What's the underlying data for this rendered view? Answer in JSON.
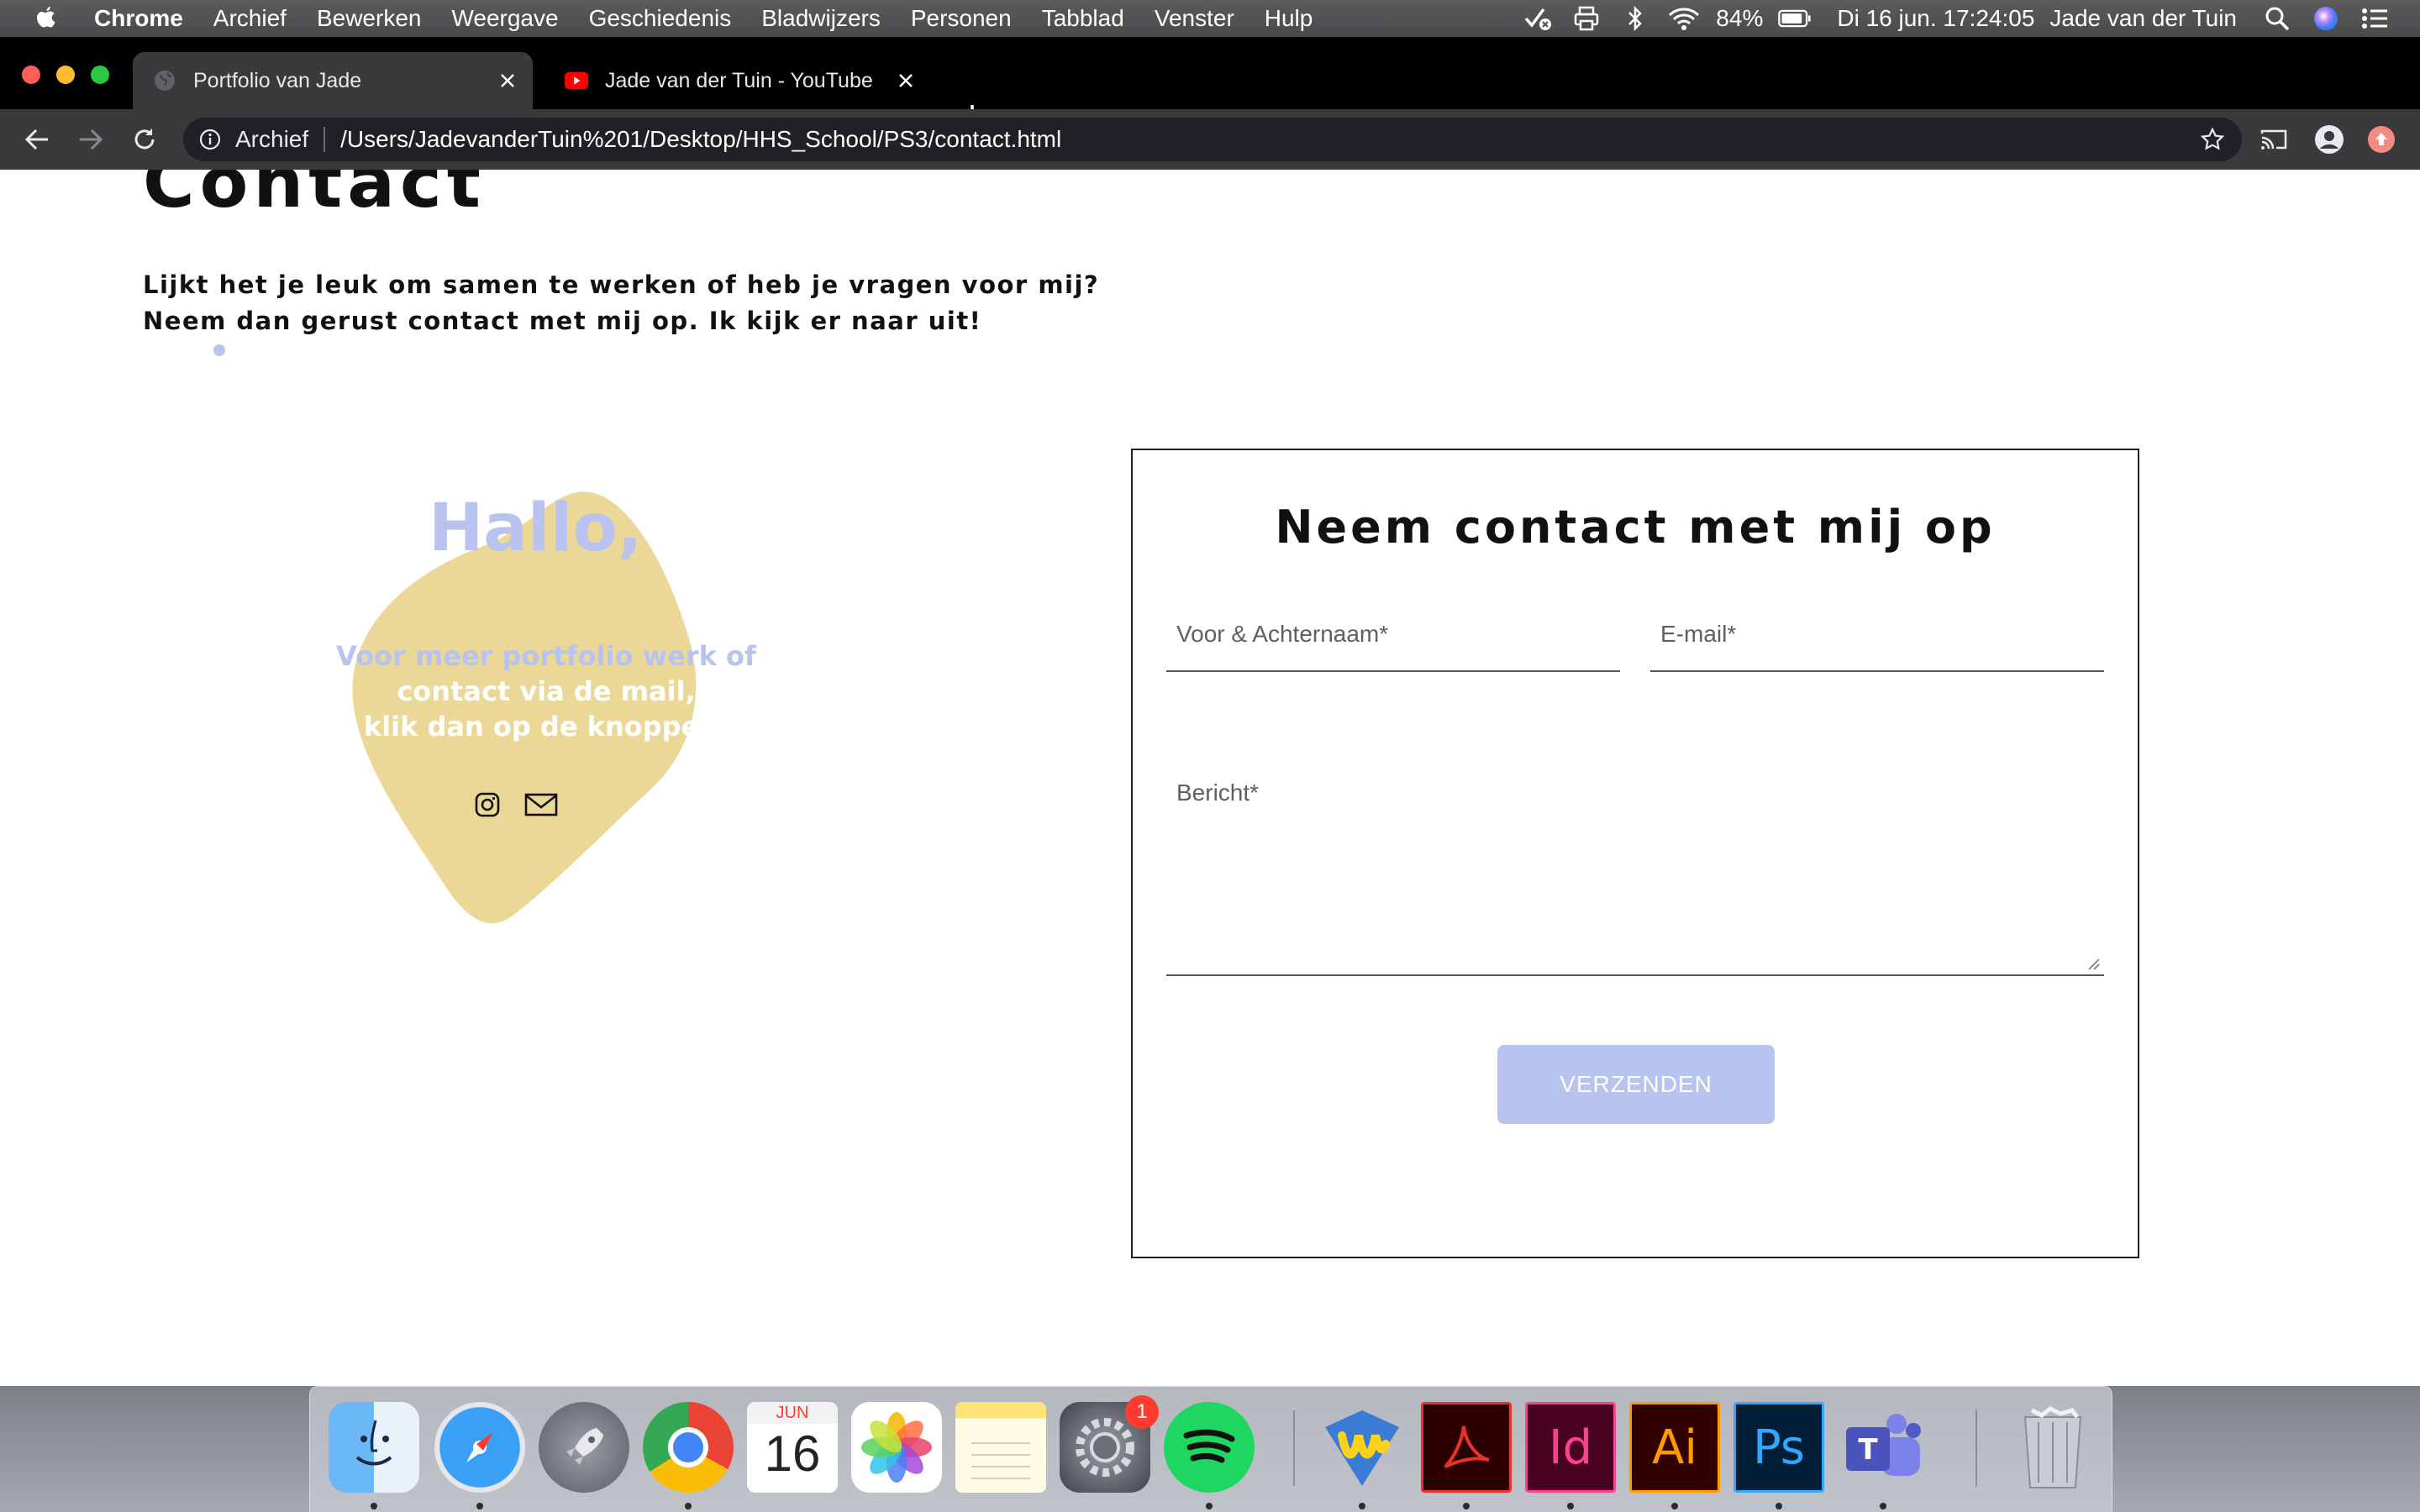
{
  "menubar": {
    "app_name": "Chrome",
    "menus": [
      "Archief",
      "Bewerken",
      "Weergave",
      "Geschiedenis",
      "Bladwijzers",
      "Personen",
      "Tabblad",
      "Venster",
      "Hulp"
    ],
    "battery": "84%",
    "datetime": "Di 16 jun.  17:24:05",
    "user": "Jade van der Tuin"
  },
  "tabs": [
    {
      "title": "Portfolio van Jade",
      "active": true
    },
    {
      "title": "Jade van der Tuin - YouTube",
      "active": false
    }
  ],
  "omnibox": {
    "scheme_label": "Archief",
    "url": "/Users/JadevanderTuin%201/Desktop/HHS_School/PS3/contact.html"
  },
  "page": {
    "title": "Contact",
    "intro_line1": "Lijkt het je leuk om samen te werken of heb je vragen voor mij?",
    "intro_line2": "Neem dan gerust contact met mij op. Ik kijk er naar uit!",
    "blob": {
      "greeting": "Hallo,",
      "line1": "Voor meer portfolio werk of",
      "line2": "contact via de mail,",
      "line3": "klik dan op de knoppen."
    },
    "form": {
      "heading": "Neem contact met mij op",
      "name_placeholder": "Voor & Achternaam*",
      "email_placeholder": "E-mail*",
      "message_placeholder": "Bericht*",
      "submit_label": "VERZENDEN"
    }
  },
  "colors": {
    "accent": "#b8c3ef",
    "blob": "#ecd896",
    "text": "#111111"
  },
  "dock": {
    "calendar_month": "JUN",
    "calendar_day": "16",
    "system_prefs_badge": "1",
    "indesign_label": "Id",
    "illustrator_label": "Ai",
    "photoshop_label": "Ps",
    "teams_label": "T"
  }
}
